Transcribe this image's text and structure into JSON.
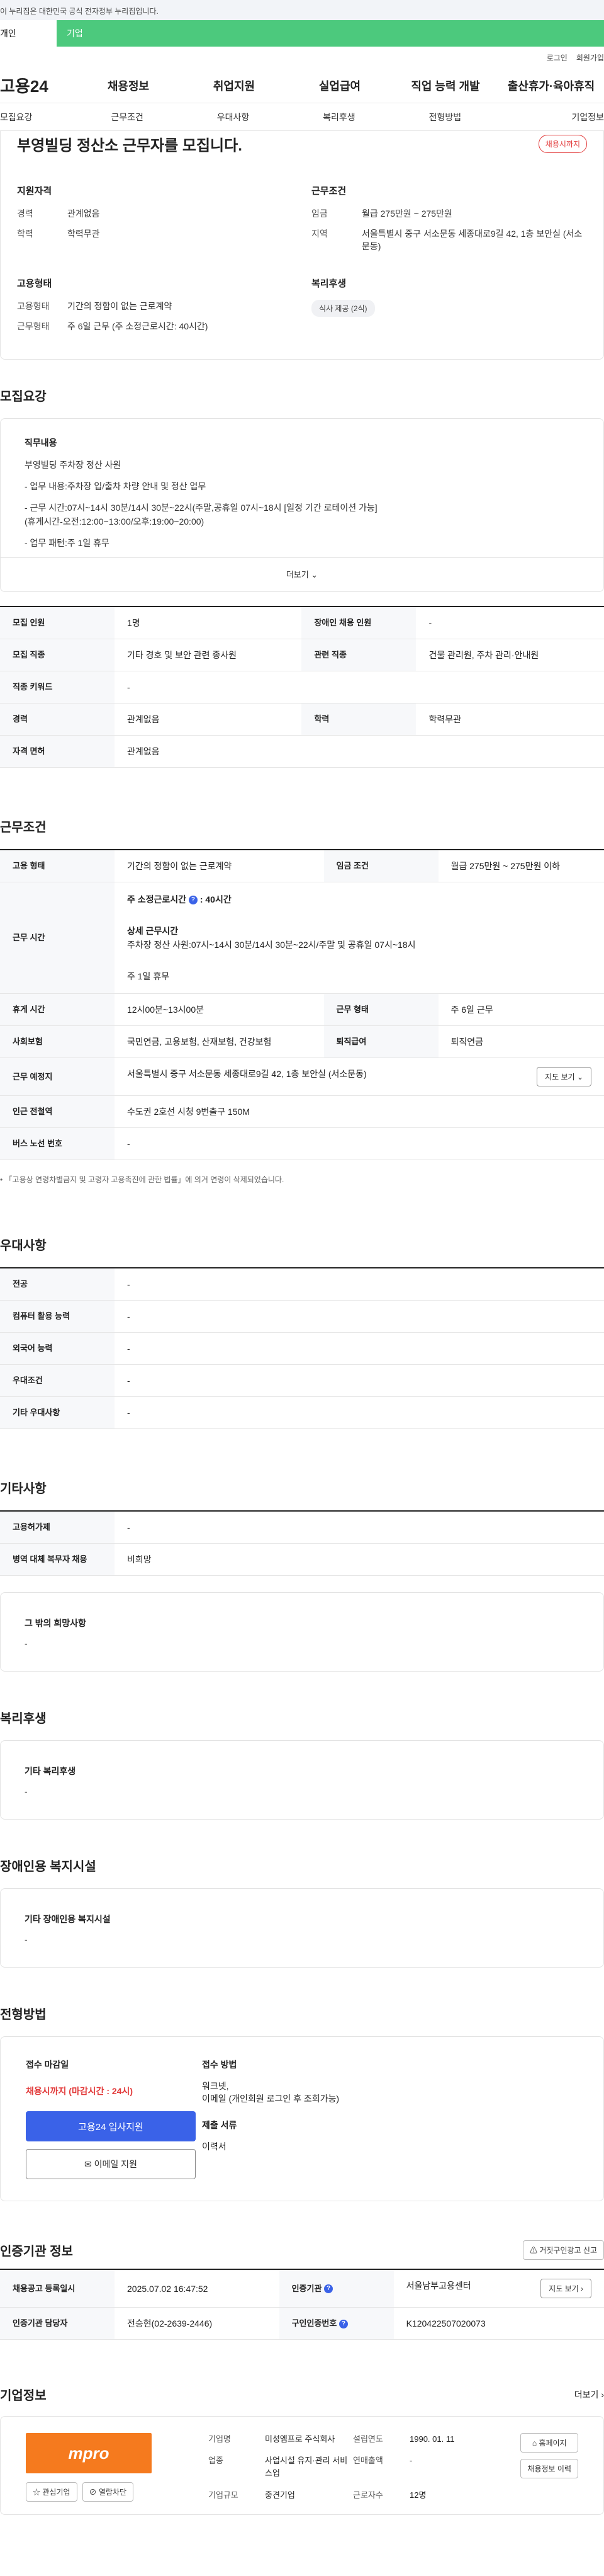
{
  "gov_banner": "이 누리집은 대한민국 공식 전자정부 누리집입니다.",
  "portal_tabs": [
    "개인",
    "기업"
  ],
  "util_links": [
    "로그인",
    "회원가입"
  ],
  "logo": "고용24",
  "gnb": [
    "채용정보",
    "취업지원",
    "실업급여",
    "직업 능력 개발",
    "출산휴가·육아휴직"
  ],
  "subnav": [
    "모집요강",
    "근무조건",
    "우대사항",
    "복리후생",
    "전형방법",
    "기업정보"
  ],
  "hero": {
    "title": "부영빌딩 정산소 근무자를 모집니다.",
    "status": "채용시까지",
    "qual_title": "지원자격",
    "qual": [
      {
        "k": "경력",
        "v": "관계없음"
      },
      {
        "k": "학력",
        "v": "학력무관"
      }
    ],
    "cond_title": "근무조건",
    "cond": [
      {
        "k": "임금",
        "v": "월급 275만원 ~ 275만원"
      },
      {
        "k": "지역",
        "v": "서울특별시 중구 서소문동 세종대로9길 42, 1층 보안실 (서소문동)"
      }
    ],
    "emp_title": "고용형태",
    "emp": [
      {
        "k": "고용형태",
        "v": "기간의 정함이 없는 근로계약"
      },
      {
        "k": "근무형태",
        "v": "주 6일 근무 (주 소정근로시간: 40시간)"
      }
    ],
    "welfare_title": "복리후생",
    "welfare_chip": "식사 제공 (2식)"
  },
  "recruit": {
    "title": "모집요강",
    "duty_title": "직무내용",
    "duty_lines": [
      "부영빌딩 주차장 정산 사원",
      "- 업무 내용:주차장 입/출차 차량 안내 및 정산 업무",
      "- 근무 시간:07시~14시 30분/14시 30분~22시(주말,공휴일 07시~18시 [일정 기간 로테이션 가능]",
      "  (휴게시간-오전:12:00~13:00/오후:19:00~20:00)",
      "- 업무 패턴:주 1일 휴무"
    ],
    "more": "더보기",
    "table": [
      {
        "k": "모집 인원",
        "v": "1명",
        "k2": "장애인 채용 인원",
        "v2": "-"
      },
      {
        "k": "모집 직종",
        "v": "기타 경호 및 보안 관련 종사원",
        "k2": "관련 직종",
        "v2": "건물 관리원, 주차 관리·안내원"
      },
      {
        "k": "직종 키워드",
        "v": "-"
      },
      {
        "k": "경력",
        "v": "관계없음",
        "k2": "학력",
        "v2": "학력무관"
      },
      {
        "k": "자격 면허",
        "v": "관계없음"
      }
    ]
  },
  "work": {
    "title": "근무조건",
    "emp_k": "고용 형태",
    "emp_v": "기간의 정함이 없는 근로계약",
    "wage_k": "임금 조건",
    "wage_v": "월급 275만원 ~ 275만원 이하",
    "time_k": "근무 시간",
    "time_total": "주 소정근로시간",
    "time_total_v": ": 40시간",
    "time_detail_t": "상세 근무시간",
    "time_detail": "주차장 정산 사원:07시~14시 30분/14시 30분~22시/주말 및 공휴일 07시~18시",
    "time_off": "주 1일 휴무",
    "rest_k": "휴게 시간",
    "rest_v": "12시00분~13시00분",
    "type_k": "근무 형태",
    "type_v": "주 6일 근무",
    "ins_k": "사회보험",
    "ins_v": "국민연금, 고용보험, 산재보험, 건강보험",
    "sev_k": "퇴직급여",
    "sev_v": "퇴직연금",
    "addr_k": "근무 예정지",
    "addr_v": "서울특별시 중구 서소문동 세종대로9길 42, 1층 보안실 (서소문동)",
    "map_btn": "지도 보기",
    "sub_k": "인근 전철역",
    "sub_v": "수도권 2호선 시청 9번출구 150M",
    "bus_k": "버스 노선 번호",
    "bus_v": "-",
    "note": "「고용상 연령차별금지 및 고령자 고용촉진에 관한 법률」에 의거 연령이 삭제되었습니다."
  },
  "pref": {
    "title": "우대사항",
    "rows": [
      {
        "k": "전공",
        "v": "-"
      },
      {
        "k": "컴퓨터 활용 능력",
        "v": "-"
      },
      {
        "k": "외국어 능력",
        "v": "-"
      },
      {
        "k": "우대조건",
        "v": "-"
      },
      {
        "k": "기타 우대사항",
        "v": "-"
      }
    ]
  },
  "etc": {
    "title": "기타사항",
    "rows": [
      {
        "k": "고용허가제",
        "v": "-"
      },
      {
        "k": "병역 대체 복무자 채용",
        "v": "비희망"
      }
    ],
    "hope_title": "그 밖의 희망사항",
    "hope_v": "-"
  },
  "benefit": {
    "title": "복리후생",
    "box_title": "기타 복리후생",
    "box_v": "-"
  },
  "disab": {
    "title": "장애인용 복지시설",
    "box_title": "기타 장애인용 복지시설",
    "box_v": "-"
  },
  "process": {
    "title": "전형방법",
    "deadline_t": "접수 마감일",
    "deadline_v": "채용시까지 (마감시간 : 24시)",
    "apply_btn": "고용24 입사지원",
    "email_btn": "이메일 지원",
    "method_t": "접수 방법",
    "method_v1": "워크넷,",
    "method_v2": "이메일 (개인회원 로그인 후 조회가능)",
    "docs_t": "제출 서류",
    "docs_v": "이력서"
  },
  "agency": {
    "title": "인증기관 정보",
    "report_btn": "거짓구인광고 신고",
    "reg_k": "채용공고 등록일시",
    "reg_v": "2025.07.02 16:47:52",
    "org_k": "인증기관",
    "org_v": "서울남부고용센터",
    "map_btn": "지도 보기",
    "mgr_k": "인증기관 담당자",
    "mgr_v": "전승현(02-2639-2446)",
    "no_k": "구인인증번호",
    "no_v": "K120422507020073"
  },
  "company": {
    "title": "기업정보",
    "more": "더보기",
    "logo_text": "mpro",
    "fav_btn": "관심기업",
    "block_btn": "열람차단",
    "info": [
      {
        "k": "기업명",
        "v": "미성엠프로 주식회사"
      },
      {
        "k": "설립연도",
        "v": "1990. 01. 11"
      },
      {
        "k": "업종",
        "v": "사업시설 유지·관리 서비스업"
      },
      {
        "k": "연매출액",
        "v": "-"
      },
      {
        "k": "기업규모",
        "v": "중견기업"
      },
      {
        "k": "근로자수",
        "v": "12명"
      }
    ],
    "home_btn": "홈페이지",
    "list_btn": "채용정보 이력"
  },
  "colors": {
    "accent": "#3a62e8",
    "green": "#4cc97d",
    "red": "#e23b3b",
    "logo": "#f57a1e"
  }
}
